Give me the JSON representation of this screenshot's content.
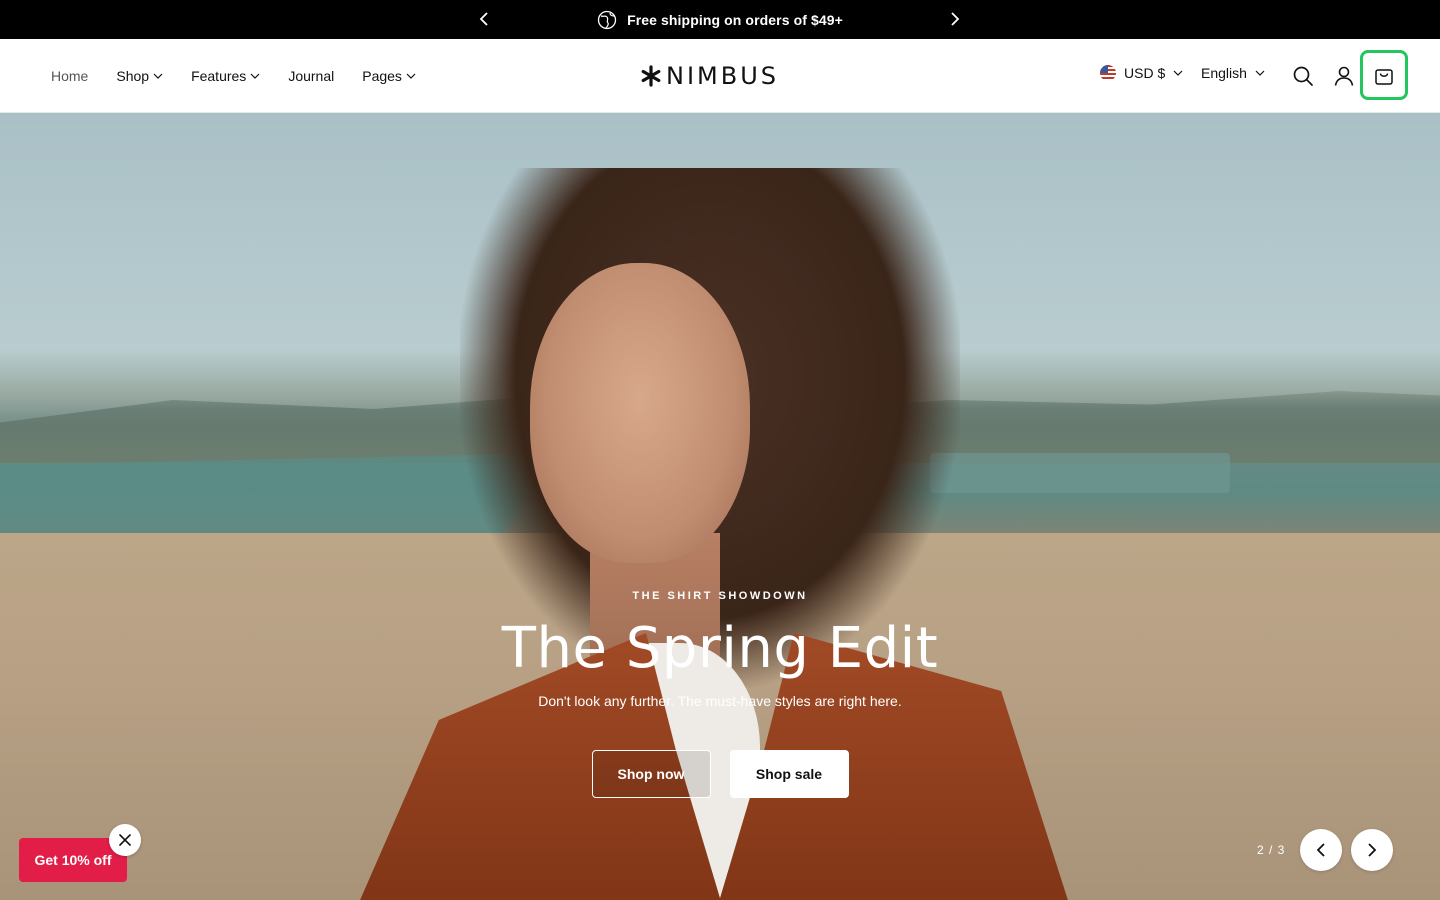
{
  "announcement": {
    "text": "Free shipping on orders of $49+",
    "icons": {
      "prev": "chevron-left-icon",
      "next": "chevron-right-icon",
      "message": "globe-icon"
    }
  },
  "header": {
    "logo_text": "NIMBUS",
    "nav": [
      {
        "label": "Home",
        "has_dropdown": false
      },
      {
        "label": "Shop",
        "has_dropdown": true
      },
      {
        "label": "Features",
        "has_dropdown": true
      },
      {
        "label": "Journal",
        "has_dropdown": false
      },
      {
        "label": "Pages",
        "has_dropdown": true
      }
    ],
    "currency": "USD $",
    "language": "English",
    "icons": [
      "search-icon",
      "account-icon",
      "cart-icon"
    ],
    "cart_highlight_color": "#22c55e"
  },
  "hero": {
    "eyebrow": "THE SHIRT SHOWDOWN",
    "headline": "The Spring Edit",
    "subtext": "Don't look any further. The must-have styles are right here.",
    "cta_primary": "Shop now",
    "cta_secondary": "Shop sale",
    "slide_counter": "2 / 3"
  },
  "promo": {
    "label": "Get 10% off",
    "color": "#e11d48"
  }
}
